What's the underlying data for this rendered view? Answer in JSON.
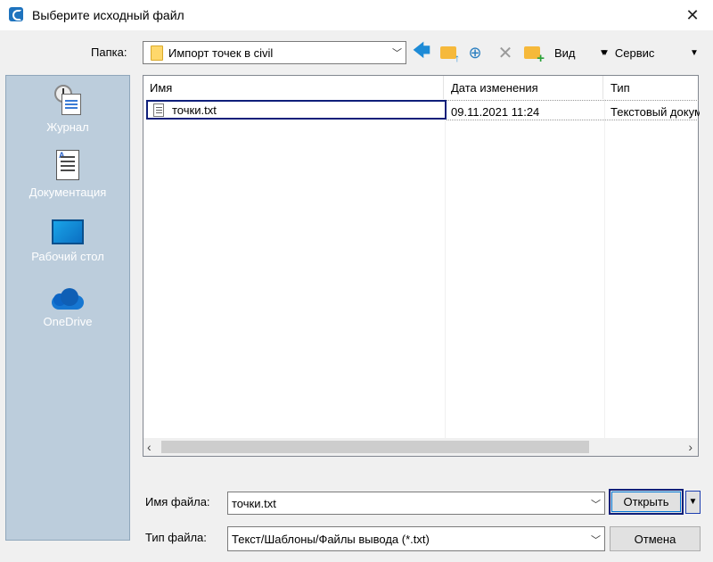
{
  "window": {
    "title": "Выберите исходный файл",
    "close_glyph": "✕"
  },
  "toolbar": {
    "folder_label": "Папка:",
    "folder_value": "Импорт точек в civil",
    "view_label": "Вид",
    "service_label": "Сервис"
  },
  "places": {
    "items": [
      {
        "label": "Журнал",
        "icon": "history-icon"
      },
      {
        "label": "Документация",
        "icon": "documents-icon"
      },
      {
        "label": "Рабочий стол",
        "icon": "desktop-icon"
      },
      {
        "label": "OneDrive",
        "icon": "onedrive-icon"
      }
    ],
    "background": "#bccddc"
  },
  "file_list": {
    "columns": [
      "Имя",
      "Дата изменения",
      "Тип"
    ],
    "rows": [
      {
        "name": "точки.txt",
        "modified": "09.11.2021 11:24",
        "type": "Текстовый документ"
      }
    ]
  },
  "footer": {
    "filename_label": "Имя файла:",
    "filename_value": "точки.txt",
    "filetype_label": "Тип файла:",
    "filetype_value": "Текст/Шаблоны/Файлы вывода (*.txt)",
    "open_label": "Открыть",
    "cancel_label": "Отмена"
  },
  "colors": {
    "accent_focus": "#0f1f7a",
    "back_arrow": "#1e8bd6",
    "folder": "#f6b93b"
  }
}
